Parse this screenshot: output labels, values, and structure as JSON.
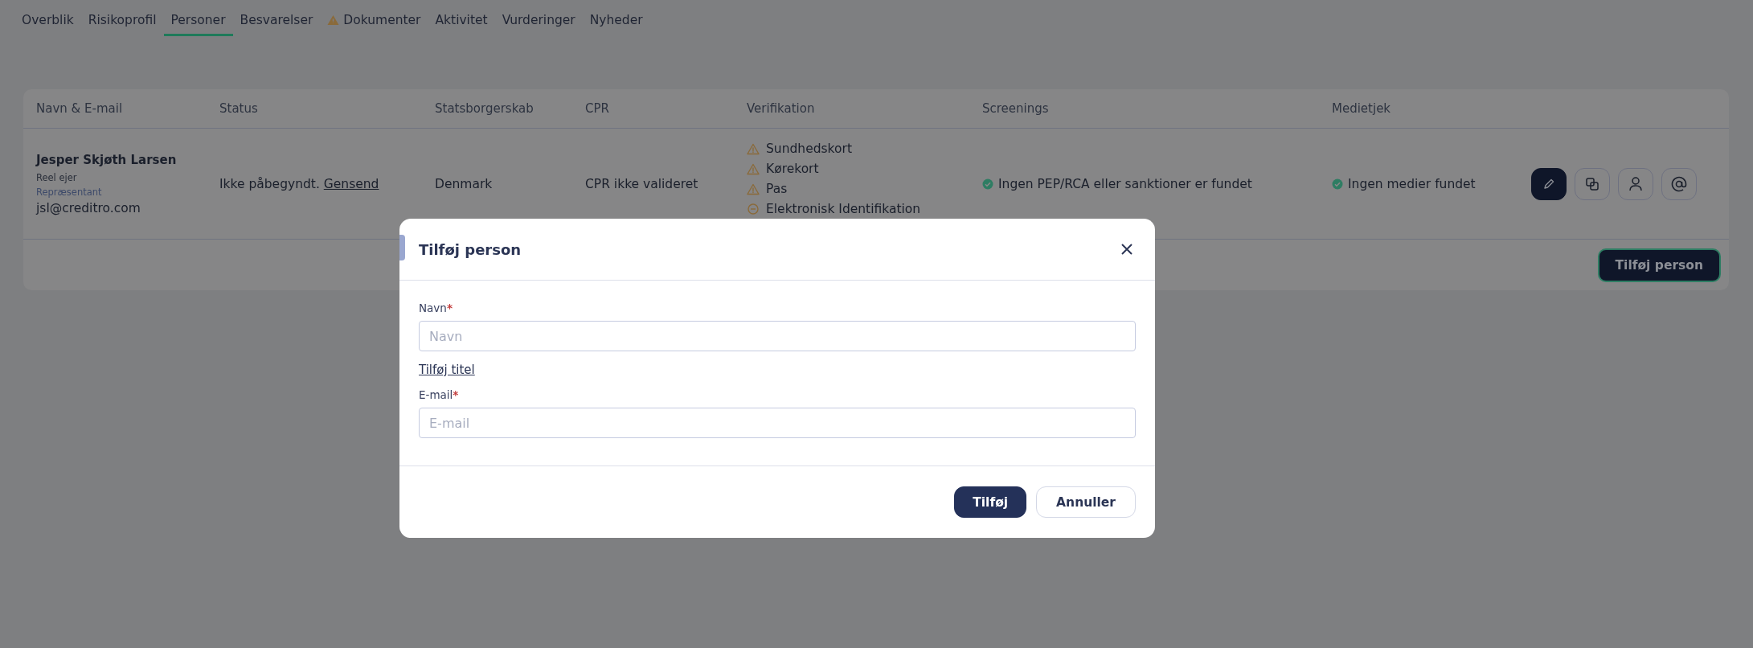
{
  "tabs": [
    {
      "label": "Overblik",
      "selected": false,
      "warning": false
    },
    {
      "label": "Risikoprofil",
      "selected": false,
      "warning": false
    },
    {
      "label": "Personer",
      "selected": true,
      "warning": false
    },
    {
      "label": "Besvarelser",
      "selected": false,
      "warning": false
    },
    {
      "label": "Dokumenter",
      "selected": false,
      "warning": true
    },
    {
      "label": "Aktivitet",
      "selected": false,
      "warning": false
    },
    {
      "label": "Vurderinger",
      "selected": false,
      "warning": false
    },
    {
      "label": "Nyheder",
      "selected": false,
      "warning": false
    }
  ],
  "table": {
    "columns": [
      "Navn & E-mail",
      "Status",
      "Statsborgerskab",
      "CPR",
      "Verifikation",
      "Screenings",
      "Medietjek"
    ],
    "rows": [
      {
        "name": "Jesper Skjøth Larsen",
        "roles": [
          "Reel ejer",
          "Repræsentant"
        ],
        "email": "jsl@creditro.com",
        "status": "Ikke påbegyndt.",
        "status_link": "Gensend",
        "citizenship": "Denmark",
        "cpr": "CPR ikke valideret",
        "verification": [
          {
            "label": "Sundhedskort",
            "kind": "warning"
          },
          {
            "label": "Kørekort",
            "kind": "warning"
          },
          {
            "label": "Pas",
            "kind": "warning"
          },
          {
            "label": "Elektronisk Identifikation",
            "kind": "pending"
          }
        ],
        "screenings": {
          "text": "Ingen PEP/RCA eller sanktioner er fundet"
        },
        "media": {
          "text": "Ingen medier fundet"
        }
      }
    ],
    "add_button": "Tilføj person"
  },
  "modal": {
    "title": "Tilføj person",
    "fields": [
      {
        "label": "Navn",
        "required_mark": "*",
        "placeholder": "Navn"
      },
      {
        "label": "E-mail",
        "required_mark": "*",
        "placeholder": "E-mail"
      }
    ],
    "link": "Tilføj titel",
    "buttons": [
      {
        "label": "Tilføj",
        "kind": "primary"
      },
      {
        "label": "Annuller",
        "kind": "secondary"
      }
    ]
  }
}
